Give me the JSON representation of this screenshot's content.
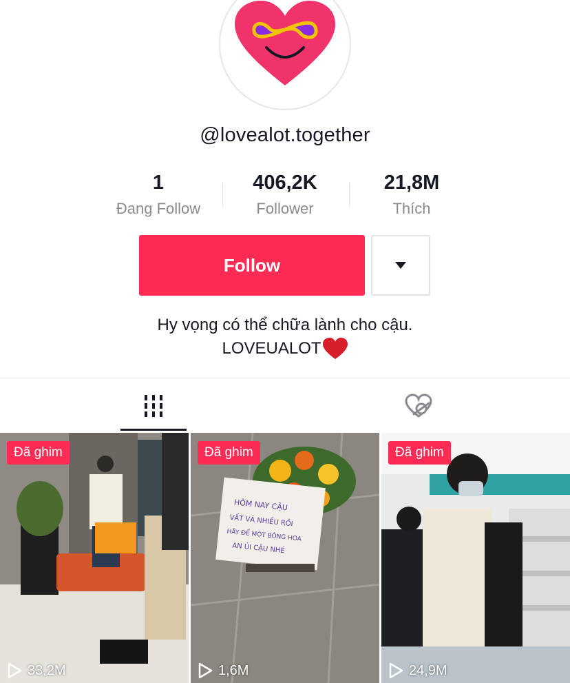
{
  "profile": {
    "username": "@lovealot.together",
    "avatar_icon": "heart-smiley-icon"
  },
  "stats": [
    {
      "value": "1",
      "label": "Đang Follow"
    },
    {
      "value": "406,2K",
      "label": "Follower"
    },
    {
      "value": "21,8M",
      "label": "Thích"
    }
  ],
  "actions": {
    "follow_label": "Follow",
    "more_icon": "caret-down-icon"
  },
  "bio": {
    "line1": "Hy vọng có thể chữa lành cho cậu.",
    "line2": "LOVEUALOT"
  },
  "tabs": [
    {
      "name": "videos",
      "icon": "grid-icon",
      "active": true
    },
    {
      "name": "liked",
      "icon": "hidden-heart-icon",
      "active": false
    }
  ],
  "videos": [
    {
      "badge": "Đã ghim",
      "views": "33,2M"
    },
    {
      "badge": "Đã ghim",
      "views": "1,6M"
    },
    {
      "badge": "Đã ghim",
      "views": "24,9M"
    }
  ],
  "colors": {
    "accent": "#fe2c55",
    "text": "#161823",
    "muted": "#8a8b91"
  }
}
